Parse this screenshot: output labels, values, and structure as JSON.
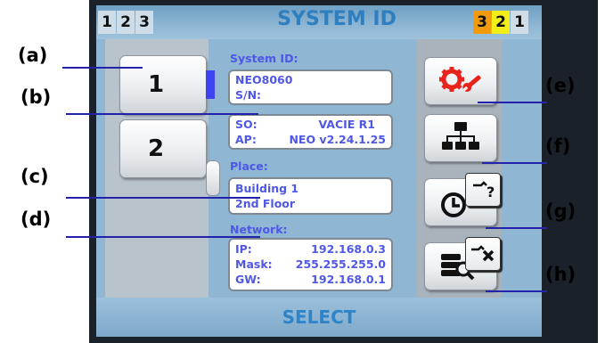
{
  "topbar": {
    "left_numbers": [
      "1",
      "2",
      "3"
    ],
    "title": "SYSTEM ID",
    "right_numbers": [
      {
        "label": "3",
        "color": "#f29a0e"
      },
      {
        "label": "2",
        "color": "#f2ee1a"
      },
      {
        "label": "1",
        "color": "#cfdde8"
      }
    ]
  },
  "channels": {
    "items": [
      {
        "label": "1",
        "selected": true
      },
      {
        "label": "2",
        "selected": false
      }
    ],
    "selected_indicator_color": "#3d43f0"
  },
  "info": {
    "system_id": {
      "header": "System ID:",
      "value": "NEO8060",
      "sn_label": "S/N:",
      "sn_value": ""
    },
    "software": {
      "so_label": "SO:",
      "so_value": "VACIE R1",
      "ap_label": "AP:",
      "ap_value": "NEO v2.24.1.25"
    },
    "place": {
      "header": "Place:",
      "line1": "Building 1",
      "line2": "2nd Floor"
    },
    "network": {
      "header": "Network:",
      "ip_label": "IP:",
      "ip_value": "192.168.0.3",
      "mask_label": "Mask:",
      "mask_value": "255.255.255.0",
      "gw_label": "GW:",
      "gw_value": "192.168.0.1"
    }
  },
  "tools": [
    {
      "icon": "settings-gear-wrench-icon"
    },
    {
      "icon": "network-topology-icon"
    },
    {
      "icon": "clock-icon",
      "secondary_icon": "help-question-icon"
    },
    {
      "icon": "database-search-icon",
      "secondary_icon": "delete-x-icon"
    }
  ],
  "bottombar": {
    "select_label": "SELECT"
  },
  "annotations": [
    "(a)",
    "(b)",
    "(c)",
    "(d)",
    "(e)",
    "(f)",
    "(g)",
    "(h)"
  ],
  "colors": {
    "accent_text": "#4f57e6",
    "title": "#2e7fc0",
    "gear": "#e8231c"
  }
}
